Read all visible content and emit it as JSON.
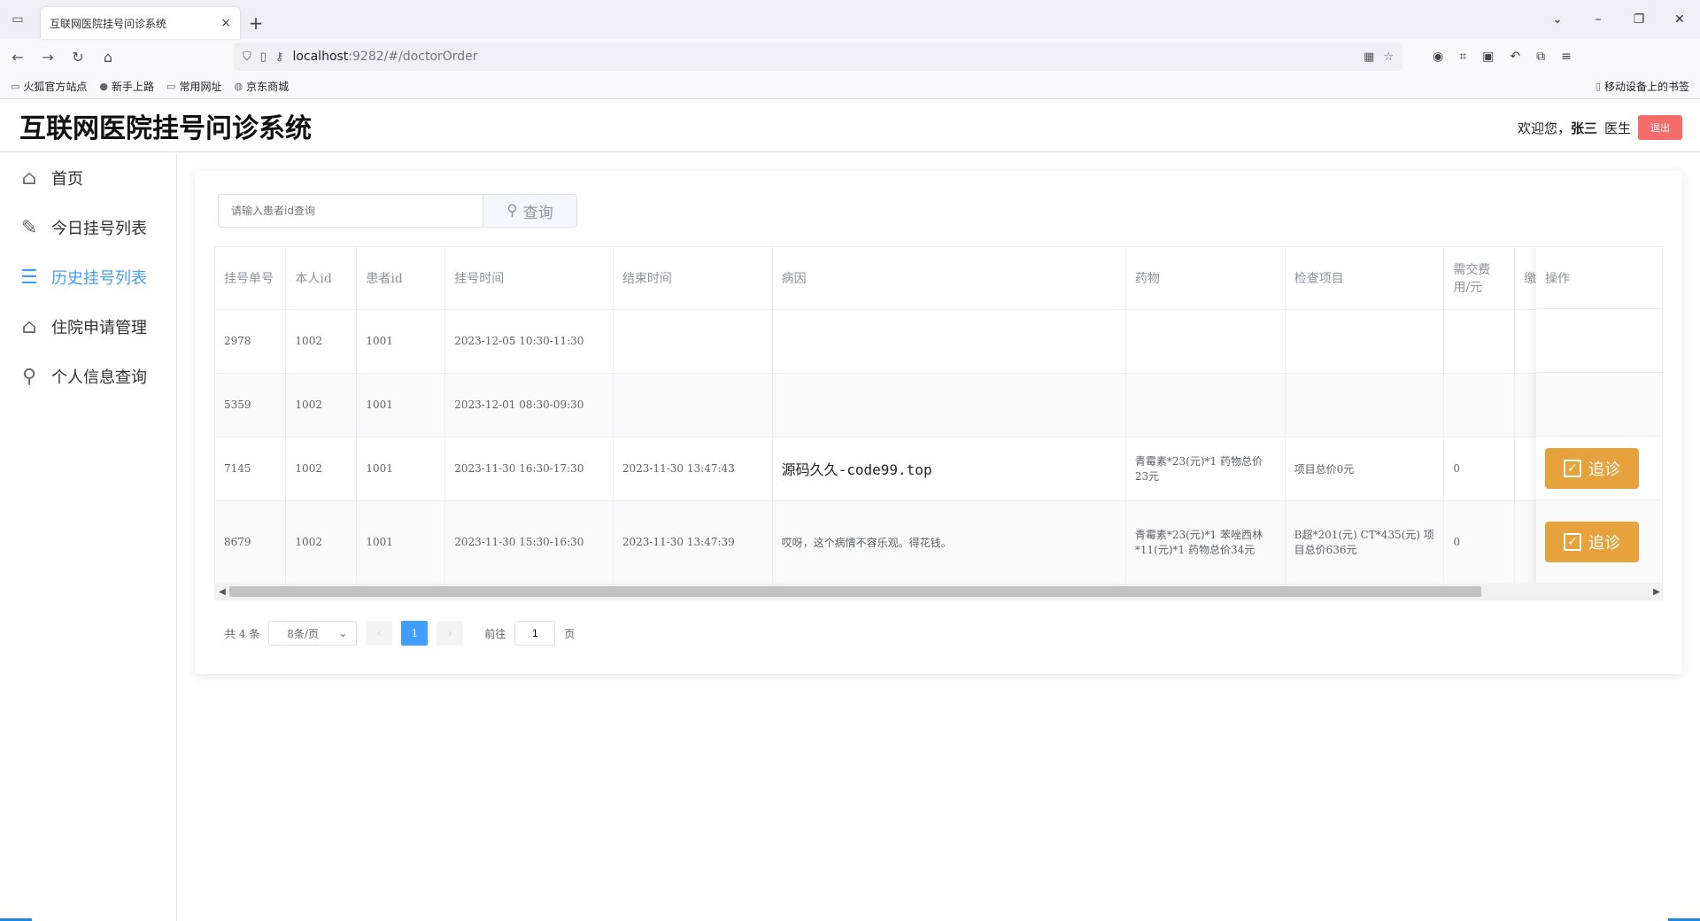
{
  "browser": {
    "tab_title": "互联网医院挂号问诊系统",
    "tab_close": "×",
    "new_tab": "+",
    "url_host": "localhost",
    "url_rest": ":9282/#/doctorOrder",
    "bookmarks": [
      "火狐官方站点",
      "新手上路",
      "常用网址",
      "京东商城"
    ],
    "mobile_bookmarks": "移动设备上的书签"
  },
  "header": {
    "title": "互联网医院挂号问诊系统",
    "welcome": "欢迎您，",
    "user_name": "张三",
    "role": "医生",
    "logout": "退出"
  },
  "sidebar": {
    "items": [
      {
        "label": "首页",
        "icon": "home-icon"
      },
      {
        "label": "今日挂号列表",
        "icon": "edit-icon"
      },
      {
        "label": "历史挂号列表",
        "icon": "list-icon",
        "active": true
      },
      {
        "label": "住院申请管理",
        "icon": "bank-icon"
      },
      {
        "label": "个人信息查询",
        "icon": "search-icon"
      }
    ]
  },
  "search": {
    "placeholder": "请输入患者id查询",
    "button": "查询"
  },
  "table": {
    "headers": [
      "挂号单号",
      "本人id",
      "患者id",
      "挂号时间",
      "结束时间",
      "病因",
      "药物",
      "检查项目",
      "需交费用/元",
      "缴",
      "操作"
    ],
    "rows": [
      {
        "order_no": "2978",
        "self_id": "1002",
        "patient_id": "1001",
        "reg_time": "2023-12-05 10:30-11:30",
        "end_time": "",
        "cause": "",
        "drugs": "",
        "exams": "",
        "fee": ""
      },
      {
        "order_no": "5359",
        "self_id": "1002",
        "patient_id": "1001",
        "reg_time": "2023-12-01 08:30-09:30",
        "end_time": "",
        "cause": "",
        "drugs": "",
        "exams": "",
        "fee": ""
      },
      {
        "order_no": "7145",
        "self_id": "1002",
        "patient_id": "1001",
        "reg_time": "2023-11-30 16:30-17:30",
        "end_time": "2023-11-30 13:47:43",
        "cause": "源码久久-code99.top",
        "drugs": "青霉素*23(元)*1 药物总价23元",
        "exams": "项目总价0元",
        "fee": "0"
      },
      {
        "order_no": "8679",
        "self_id": "1002",
        "patient_id": "1001",
        "reg_time": "2023-11-30 15:30-16:30",
        "end_time": "2023-11-30 13:47:39",
        "cause": "哎呀，这个病情不容乐观。得花钱。",
        "drugs": "青霉素*23(元)*1 苯唑西林*11(元)*1 药物总价34元",
        "exams": "B超*201(元) CT*435(元) 项目总价636元",
        "fee": "0"
      }
    ],
    "followup_label": "追诊"
  },
  "pager": {
    "total": "共 4 条",
    "page_size": "8条/页",
    "prev": "‹",
    "current": "1",
    "next": "›",
    "goto": "前往",
    "goto_value": "1",
    "page_unit": "页"
  }
}
